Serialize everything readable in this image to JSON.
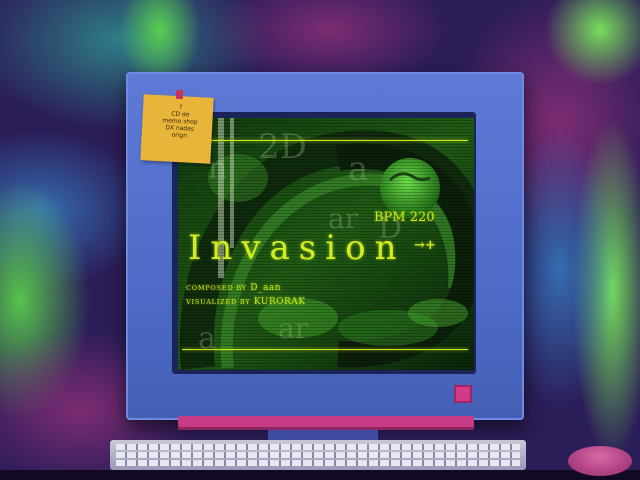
{
  "game": {
    "song_title": "Invasion",
    "bpm_label": "BPM 220",
    "arrow_glyph": "→+",
    "composer": {
      "prefix": "composed by",
      "name": "D_aan"
    },
    "visualizer": {
      "prefix": "visualized by",
      "name": "KURORAK"
    },
    "screen_bg_letters": [
      "n",
      "2D",
      "a",
      "D",
      "ar",
      "ar",
      "a"
    ]
  },
  "sticky_note": {
    "lines": [
      "?",
      "CD de",
      "memo shop",
      "DX nadas",
      "orign"
    ]
  },
  "colors": {
    "hud_text": "#c8e81a",
    "monitor_body": "#5d7ad6",
    "monitor_stand": "#c73a86",
    "power_button": "#d23a8a",
    "sticky_note": "#e8b53a",
    "background_purple": "#2b1d58",
    "background_green": "#4ad62a"
  },
  "icons": {
    "power_button": "power-button-square",
    "sticky_pin": "pin-icon",
    "globe": "globe-icon"
  }
}
